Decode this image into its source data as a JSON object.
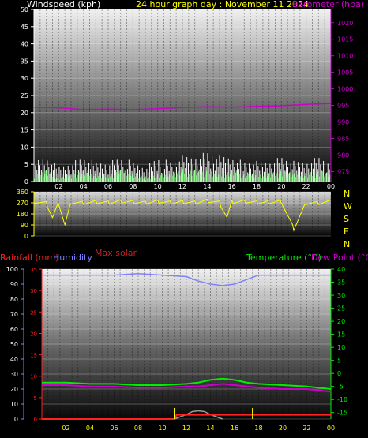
{
  "header": {
    "left_label": "Windspeed (kph)",
    "center_label": "24 hour graph day : November 11 2024",
    "right_label": "Barometer (hpa)"
  },
  "compass": [
    "N",
    "W",
    "S",
    "E",
    "N"
  ],
  "mid_label": "Max solar",
  "bottom_labels": {
    "rain": "Rainfall (mm)",
    "humidity": "Humidity",
    "temperature": "Temperature (°C)",
    "dewpoint": "Dew Point (°C)"
  },
  "colors": {
    "wind_axis": "#ffffff",
    "barometer": "#cc00cc",
    "title": "#ffff00",
    "winddir": "#ffff00",
    "rain": "#ff2020",
    "humidity": "#8080ff",
    "temperature": "#00ee00",
    "dewpoint": "#cc00cc",
    "solar": "#cc2020",
    "solar_gray": "#999999"
  },
  "x_ticks": [
    "02",
    "04",
    "06",
    "08",
    "10",
    "12",
    "14",
    "16",
    "18",
    "20",
    "22",
    "00"
  ],
  "chart_data": [
    {
      "type": "line",
      "panel": "wind_barometer",
      "x_range": [
        0,
        24
      ],
      "y_left": {
        "label": "Windspeed (kph)",
        "range": [
          0,
          50
        ],
        "ticks": [
          0,
          5,
          10,
          15,
          20,
          25,
          30,
          35,
          40,
          45,
          50
        ]
      },
      "y_right": {
        "label": "Barometer (hpa)",
        "range": [
          972,
          1024
        ],
        "ticks": [
          975,
          980,
          985,
          990,
          995,
          1000,
          1005,
          1010,
          1015,
          1020
        ]
      },
      "series": [
        {
          "name": "Barometer (hpa)",
          "axis": "right",
          "x": [
            0,
            2,
            4,
            6,
            8,
            10,
            12,
            14,
            16,
            18,
            20,
            22,
            24
          ],
          "values": [
            994.5,
            994.3,
            993.7,
            993.9,
            993.7,
            994.0,
            994.4,
            994.6,
            994.5,
            994.7,
            994.9,
            995.3,
            995.6
          ]
        },
        {
          "name": "Windspeed (kph)",
          "axis": "left",
          "x": [
            0,
            1,
            2,
            3,
            4,
            5,
            6,
            7,
            8,
            9,
            10,
            11,
            12,
            13,
            14,
            15,
            16,
            17,
            18,
            19,
            20,
            21,
            22,
            23,
            24
          ],
          "values": [
            2,
            3,
            1,
            2,
            3,
            2,
            2,
            3,
            2,
            1,
            2,
            2,
            3,
            3,
            3,
            2,
            3,
            2,
            2,
            2,
            3,
            2,
            2,
            3,
            2
          ]
        },
        {
          "name": "Wind Gust (kph)",
          "axis": "left",
          "x": [
            0,
            1,
            2,
            3,
            4,
            5,
            6,
            7,
            8,
            9,
            10,
            11,
            12,
            13,
            14,
            15,
            16,
            17,
            18,
            19,
            20,
            21,
            22,
            23,
            24
          ],
          "values": [
            4,
            5,
            3,
            4,
            5,
            4,
            4,
            5,
            4,
            3,
            5,
            4,
            5,
            5,
            6,
            5,
            5,
            4,
            4,
            4,
            5,
            4,
            4,
            5,
            4
          ]
        }
      ]
    },
    {
      "type": "line",
      "panel": "wind_direction",
      "x_range": [
        0,
        24
      ],
      "y": {
        "range": [
          0,
          360
        ],
        "ticks": [
          0,
          90,
          180,
          270,
          360
        ]
      },
      "series": [
        {
          "name": "Wind direction",
          "x": [
            0,
            1,
            1.5,
            2,
            2.5,
            3,
            4,
            5,
            6,
            7,
            8,
            9,
            10,
            11,
            12,
            13,
            14,
            15,
            15.6,
            16,
            17,
            18,
            19,
            20,
            21,
            22,
            23,
            24
          ],
          "values": [
            280,
            265,
            150,
            270,
            90,
            275,
            270,
            275,
            270,
            280,
            275,
            270,
            280,
            270,
            275,
            270,
            285,
            270,
            150,
            275,
            280,
            270,
            275,
            280,
            60,
            270,
            270,
            280
          ]
        }
      ]
    },
    {
      "type": "line",
      "panel": "rain_humidity_temperature",
      "x_range": [
        0,
        24
      ],
      "y_left": {
        "label": "Humidity",
        "range": [
          0,
          100
        ],
        "ticks": [
          0,
          10,
          20,
          30,
          40,
          50,
          60,
          70,
          80,
          90,
          100
        ]
      },
      "y_rain": {
        "label": "Rainfall (mm)",
        "range": [
          0,
          35
        ],
        "ticks": [
          0,
          5,
          10,
          15,
          20,
          25,
          30,
          35
        ]
      },
      "y_right": {
        "label": "Temperature (°C)",
        "range": [
          -17.5,
          40
        ],
        "ticks": [
          -15,
          -10,
          -5,
          0,
          5,
          10,
          15,
          20,
          25,
          30,
          35,
          40
        ]
      },
      "series": [
        {
          "name": "Humidity",
          "axis": "left",
          "x": [
            0,
            2,
            4,
            6,
            8,
            10,
            12,
            13,
            14,
            15,
            16,
            17,
            18,
            20,
            22,
            24
          ],
          "values": [
            96,
            96,
            96,
            96,
            97,
            96,
            95,
            92,
            90,
            89,
            90,
            93,
            96,
            96,
            96,
            96
          ]
        },
        {
          "name": "Temperature (°C)",
          "axis": "right",
          "x": [
            0,
            2,
            4,
            6,
            8,
            10,
            12,
            13,
            14,
            15,
            16,
            17,
            18,
            20,
            22,
            24
          ],
          "values": [
            -3.5,
            -3.5,
            -4.0,
            -4.0,
            -4.5,
            -4.5,
            -4.0,
            -3.5,
            -2.5,
            -2.0,
            -2.5,
            -3.5,
            -4.0,
            -4.5,
            -5.0,
            -6.0
          ]
        },
        {
          "name": "Dew Point (°C)",
          "axis": "right",
          "x": [
            0,
            2,
            4,
            6,
            8,
            10,
            12,
            13,
            14,
            15,
            16,
            17,
            18,
            20,
            22,
            24
          ],
          "values": [
            -4.5,
            -4.5,
            -5.0,
            -5.0,
            -5.5,
            -5.5,
            -5.0,
            -5.0,
            -4.5,
            -4.0,
            -4.5,
            -5.0,
            -5.5,
            -6.0,
            -6.0,
            -7.0
          ]
        },
        {
          "name": "Rainfall (mm)",
          "axis": "rain",
          "x": [
            0,
            11,
            11.2,
            23.8,
            24
          ],
          "values": [
            0,
            0,
            1,
            1,
            1
          ]
        },
        {
          "name": "Max solar",
          "axis": "left",
          "x": [
            11,
            12,
            12.5,
            13,
            13.5,
            14,
            15
          ],
          "values": [
            0,
            3,
            5,
            5.5,
            5,
            3,
            0
          ]
        }
      ]
    }
  ]
}
